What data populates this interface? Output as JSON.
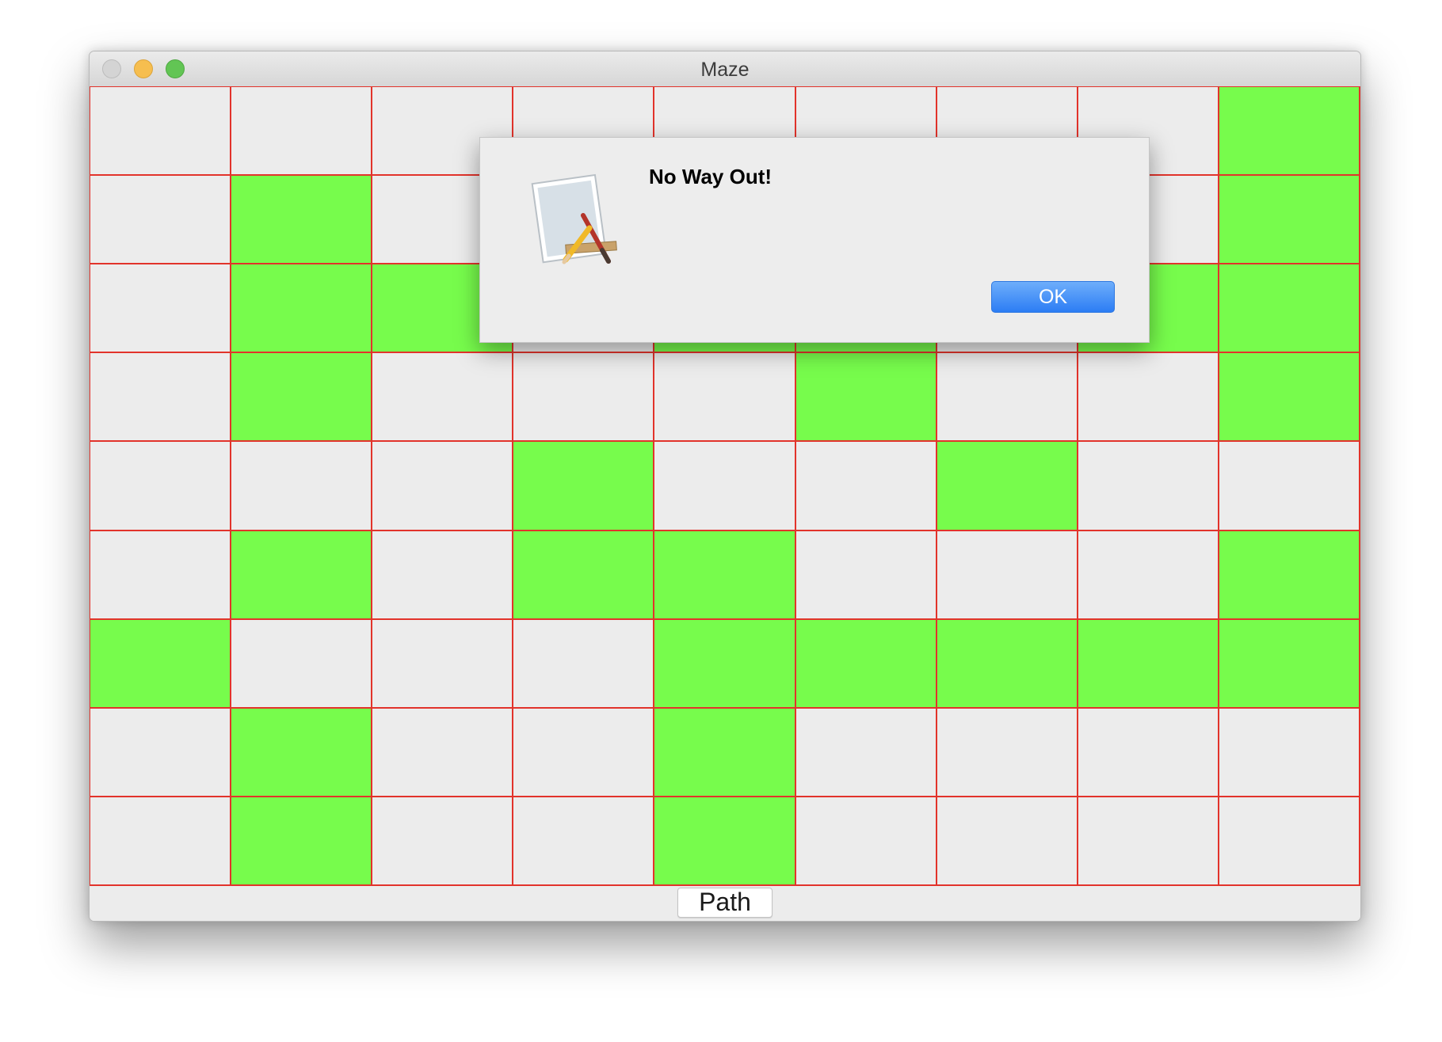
{
  "window": {
    "title": "Maze"
  },
  "maze": {
    "rows": 9,
    "cols": 9,
    "open_color": "#77fc4c",
    "wall_color": "#ececec",
    "grid_line_color": "#e2332b",
    "cells": [
      [
        0,
        0,
        0,
        0,
        0,
        0,
        0,
        0,
        1
      ],
      [
        0,
        1,
        0,
        0,
        0,
        0,
        0,
        0,
        1
      ],
      [
        0,
        1,
        1,
        0,
        1,
        1,
        0,
        1,
        1
      ],
      [
        0,
        1,
        0,
        0,
        0,
        1,
        0,
        0,
        1
      ],
      [
        0,
        0,
        0,
        1,
        0,
        0,
        1,
        0,
        0
      ],
      [
        0,
        1,
        0,
        1,
        1,
        0,
        0,
        0,
        1
      ],
      [
        1,
        0,
        0,
        0,
        1,
        1,
        1,
        1,
        1
      ],
      [
        0,
        1,
        0,
        0,
        1,
        0,
        0,
        0,
        0
      ],
      [
        0,
        1,
        0,
        0,
        1,
        0,
        0,
        0,
        0
      ]
    ]
  },
  "bottom_bar": {
    "path_button_label": "Path"
  },
  "alert": {
    "icon": "app-icon",
    "message": "No Way Out!",
    "ok_label": "OK",
    "ok_color": "#2c7df4"
  }
}
